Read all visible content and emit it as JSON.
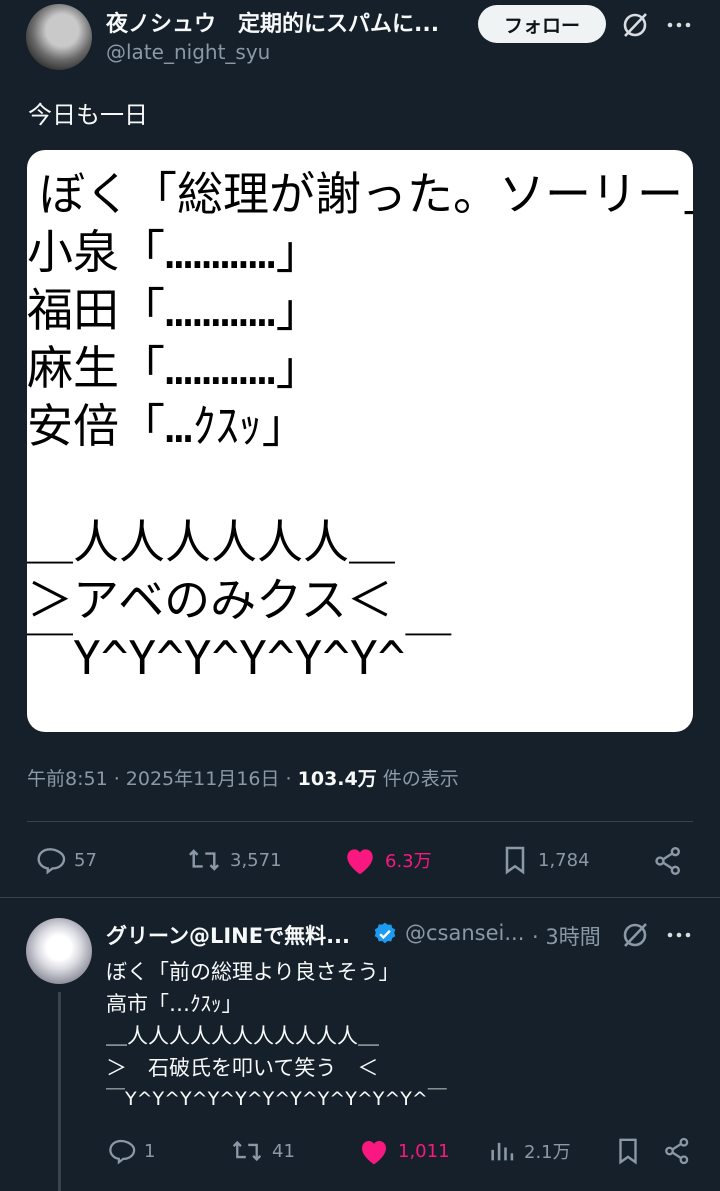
{
  "tweet": {
    "author_name": "夜ノシュウ　定期的にスパムに...",
    "handle": "@late_night_syu",
    "follow_label": "フォロー",
    "text": "今日も一日",
    "media_lines": [
      "ぼく「総理が謝った。ソーリー」",
      "小泉「…………」",
      "福田「…………」",
      "麻生「…………」",
      "安倍「…ｸｽｯ」",
      "",
      "＿人人人人人人＿",
      "＞アベのみクス＜",
      "￣Y^Y^Y^Y^Y^Y^￣"
    ],
    "time": "午前8:51 · 2025年11月16日 · ",
    "views": "103.4万",
    "views_suffix": " 件の表示",
    "stats": {
      "replies": "57",
      "retweets": "3,571",
      "likes": "6.3万",
      "bookmarks": "1,784"
    }
  },
  "reply": {
    "author_name": "グリーン@LINEで無料...",
    "handle": "@csansei...",
    "time": "· 3時間",
    "lines": [
      "ぼく「前の総理より良さそう」",
      "高市「…ｸｽｯ」",
      "＿人人人人人人人人人人人＿",
      "＞　石破氏を叩いて笑う　＜",
      "￣Y^Y^Y^Y^Y^Y^Y^Y^Y^Y^Y^￣"
    ],
    "stats": {
      "replies": "1",
      "retweets": "41",
      "likes": "1,011",
      "views": "2.1万"
    }
  },
  "colors": {
    "background": "#15202b",
    "like_pink": "#f91880",
    "verified_blue": "#1d9bf0",
    "muted": "#8b98a5"
  }
}
